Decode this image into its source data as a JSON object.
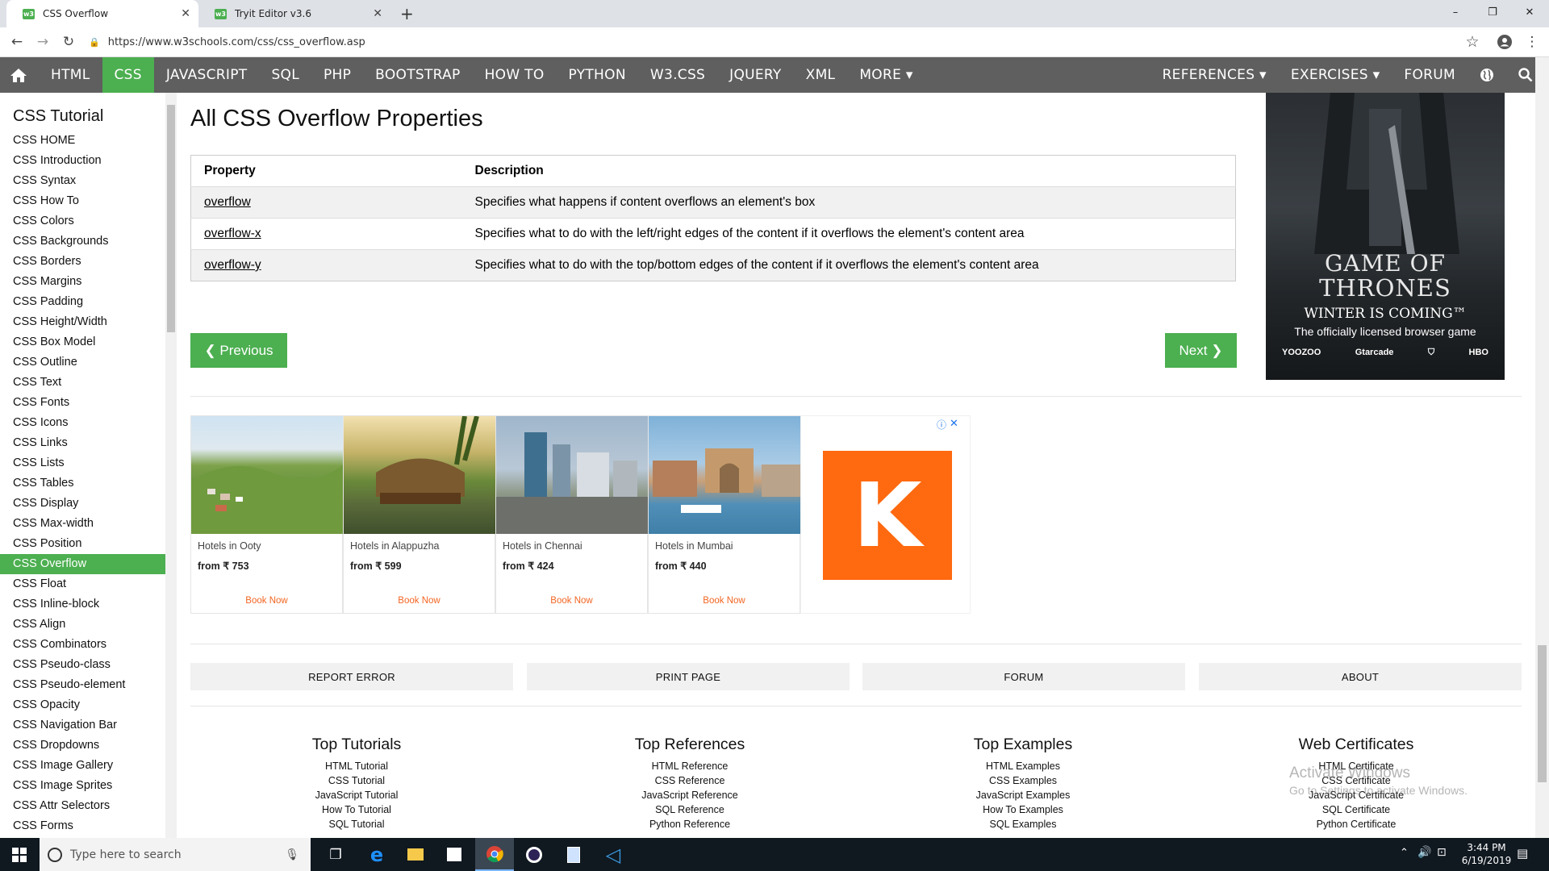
{
  "browser": {
    "tabs": [
      {
        "title": "CSS Overflow"
      },
      {
        "title": "Tryit Editor v3.6"
      }
    ],
    "url": "https://www.w3schools.com/css/css_overflow.asp",
    "new_tab": "+",
    "controls": {
      "minimize": "–",
      "maximize": "❐",
      "close": "✕"
    }
  },
  "topnav": {
    "items": [
      "HTML",
      "CSS",
      "JAVASCRIPT",
      "SQL",
      "PHP",
      "BOOTSTRAP",
      "HOW TO",
      "PYTHON",
      "W3.CSS",
      "JQUERY",
      "XML",
      "MORE ▾"
    ],
    "active": "CSS",
    "right": [
      "REFERENCES ▾",
      "EXERCISES ▾",
      "FORUM"
    ]
  },
  "sidebar": {
    "title": "CSS Tutorial",
    "items": [
      "CSS HOME",
      "CSS Introduction",
      "CSS Syntax",
      "CSS How To",
      "CSS Colors",
      "CSS Backgrounds",
      "CSS Borders",
      "CSS Margins",
      "CSS Padding",
      "CSS Height/Width",
      "CSS Box Model",
      "CSS Outline",
      "CSS Text",
      "CSS Fonts",
      "CSS Icons",
      "CSS Links",
      "CSS Lists",
      "CSS Tables",
      "CSS Display",
      "CSS Max-width",
      "CSS Position",
      "CSS Overflow",
      "CSS Float",
      "CSS Inline-block",
      "CSS Align",
      "CSS Combinators",
      "CSS Pseudo-class",
      "CSS Pseudo-element",
      "CSS Opacity",
      "CSS Navigation Bar",
      "CSS Dropdowns",
      "CSS Image Gallery",
      "CSS Image Sprites",
      "CSS Attr Selectors",
      "CSS Forms"
    ],
    "active": "CSS Overflow"
  },
  "main": {
    "heading": "All CSS Overflow Properties",
    "table": {
      "headers": [
        "Property",
        "Description"
      ],
      "rows": [
        {
          "prop": "overflow",
          "desc": "Specifies what happens if content overflows an element's box"
        },
        {
          "prop": "overflow-x",
          "desc": "Specifies what to do with the left/right edges of the content if it overflows the element's content area"
        },
        {
          "prop": "overflow-y",
          "desc": "Specifies what to do with the top/bottom edges of the content if it overflows the element's content area"
        }
      ]
    },
    "prev_label": "❮ Previous",
    "next_label": "Next ❯"
  },
  "side_ad": {
    "line1": "GAME OF",
    "line2": "THRONES",
    "line3": "WINTER IS COMING™",
    "line4": "The officially licensed browser game",
    "brands": [
      "YOOZOO",
      "Gtarcade",
      "HBO"
    ]
  },
  "hotel_ad": {
    "cards": [
      {
        "title": "Hotels in Ooty",
        "price": "from ₹ 753",
        "cta": "Book Now"
      },
      {
        "title": "Hotels in Alappuzha",
        "price": "from ₹ 599",
        "cta": "Book Now"
      },
      {
        "title": "Hotels in Chennai",
        "price": "from ₹ 424",
        "cta": "Book Now"
      },
      {
        "title": "Hotels in Mumbai",
        "price": "from ₹ 440",
        "cta": "Book Now"
      }
    ],
    "logo_letter": "K"
  },
  "footer_buttons": [
    "REPORT ERROR",
    "PRINT PAGE",
    "FORUM",
    "ABOUT"
  ],
  "footer_columns": [
    {
      "title": "Top Tutorials",
      "links": [
        "HTML Tutorial",
        "CSS Tutorial",
        "JavaScript Tutorial",
        "How To Tutorial",
        "SQL Tutorial"
      ]
    },
    {
      "title": "Top References",
      "links": [
        "HTML Reference",
        "CSS Reference",
        "JavaScript Reference",
        "SQL Reference",
        "Python Reference"
      ]
    },
    {
      "title": "Top Examples",
      "links": [
        "HTML Examples",
        "CSS Examples",
        "JavaScript Examples",
        "How To Examples",
        "SQL Examples"
      ]
    },
    {
      "title": "Web Certificates",
      "links": [
        "HTML Certificate",
        "CSS Certificate",
        "JavaScript Certificate",
        "SQL Certificate",
        "Python Certificate"
      ]
    }
  ],
  "watermark": {
    "line1": "Activate Windows",
    "line2": "Go to Settings to activate Windows."
  },
  "taskbar": {
    "search_placeholder": "Type here to search",
    "time": "3:44 PM",
    "date": "6/19/2019"
  }
}
